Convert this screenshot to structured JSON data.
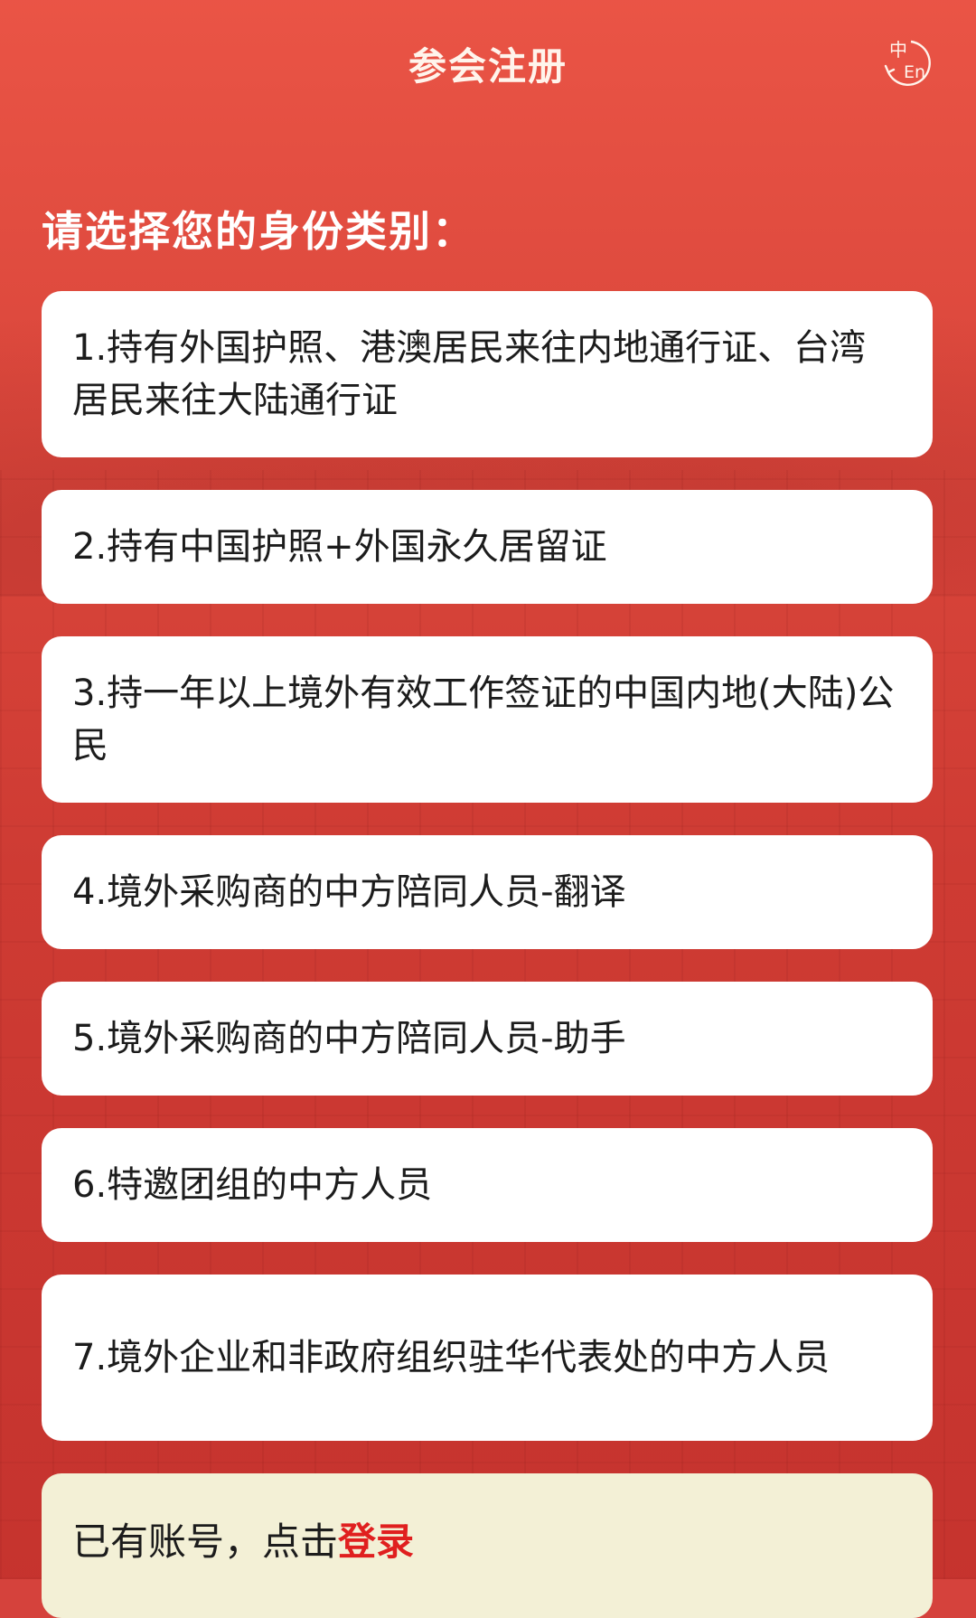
{
  "header": {
    "title": "参会注册",
    "lang_icon": "zh-en-switch-icon",
    "lang_zh": "中",
    "lang_en": "En"
  },
  "section": {
    "title": "请选择您的身份类别："
  },
  "options": [
    {
      "label": "1.持有外国护照、港澳居民来往内地通行证、台湾居民来往大陆通行证"
    },
    {
      "label": "2.持有中国护照+外国永久居留证"
    },
    {
      "label": "3.持一年以上境外有效工作签证的中国内地(大陆)公民"
    },
    {
      "label": "4.境外采购商的中方陪同人员-翻译"
    },
    {
      "label": "5.境外采购商的中方陪同人员-助手"
    },
    {
      "label": "6.特邀团组的中方人员"
    },
    {
      "label": "7.境外企业和非政府组织驻华代表处的中方人员"
    }
  ],
  "login": {
    "prefix": "已有账号，点击",
    "link": "登录"
  },
  "colors": {
    "background": "#d5423c",
    "card": "#ffffff",
    "login_card": "#f3f0d6",
    "link": "#e01f1f"
  }
}
